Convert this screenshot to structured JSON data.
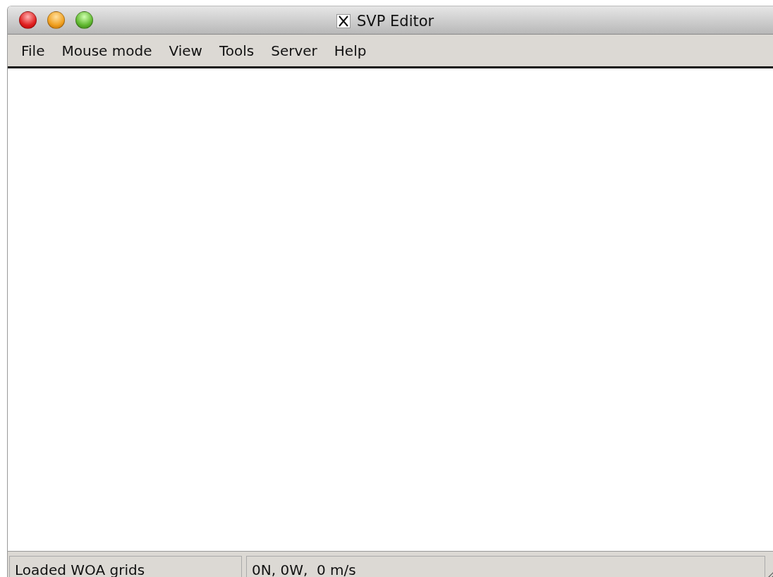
{
  "window": {
    "title": "SVP Editor"
  },
  "menu": [
    "File",
    "Mouse mode",
    "View",
    "Tools",
    "Server",
    "Help"
  ],
  "status_bar": [
    "Loaded WOA grids",
    "0N, 0W,  0 m/s"
  ]
}
